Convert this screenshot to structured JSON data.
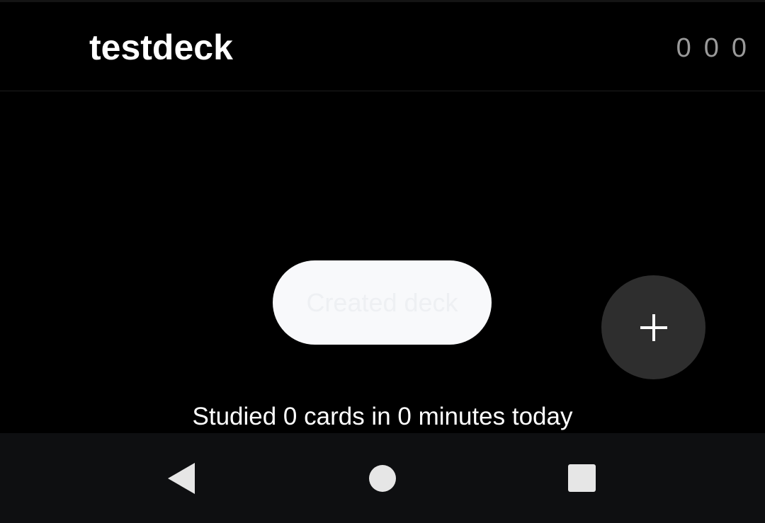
{
  "deck": {
    "name": "testdeck",
    "counts": [
      "0",
      "0",
      "0"
    ]
  },
  "snackbar": {
    "message": "Created deck"
  },
  "fab": {
    "icon": "plus-icon"
  },
  "study_stats": {
    "text": "Studied 0 cards in 0 minutes today"
  },
  "nav_bar": {
    "buttons": [
      {
        "icon": "back-icon"
      },
      {
        "icon": "home-icon"
      },
      {
        "icon": "recents-icon"
      }
    ]
  },
  "colors": {
    "background": "#000000",
    "snackbar": "#f8f9fb",
    "fab": "#2e2e2e",
    "count": "#9a9a9a",
    "nav_bar": "#0e0f11"
  }
}
